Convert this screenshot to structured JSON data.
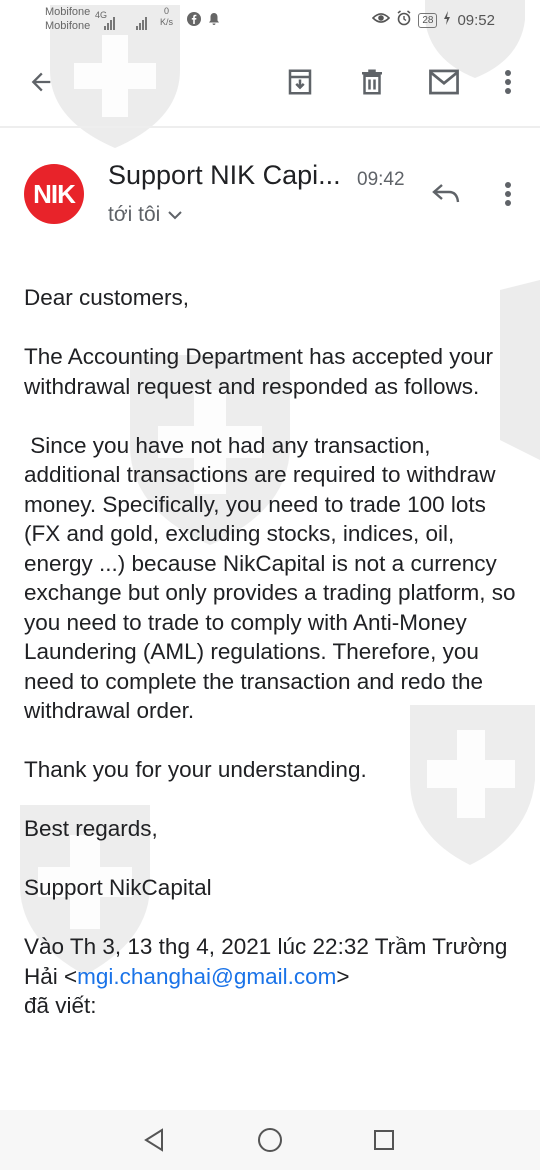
{
  "status_bar": {
    "carrier_1": "Mobifone",
    "carrier_2": "Mobifone",
    "network_1": "4G",
    "speed_value": "0",
    "speed_unit": "K/s",
    "battery": "28",
    "clock": "09:52"
  },
  "toolbar": {
    "icons": [
      "back-arrow-icon",
      "archive-icon",
      "delete-icon",
      "mark-unread-icon",
      "more-vert-icon"
    ]
  },
  "email": {
    "avatar_text": "NIK",
    "sender": "Support NIK Capi...",
    "time": "09:42",
    "recipient_label": "tới tôi",
    "body": {
      "greeting": "Dear customers,",
      "para1": "The Accounting Department has accepted your withdrawal request and responded as follows.",
      "para2": " Since you have not had any transaction, additional transactions are required to withdraw money. Specifically, you need to trade 100 lots (FX and gold, excluding stocks, indices, oil, energy ...) because NikCapital is not a currency exchange but only provides a trading platform, so you need to trade to comply with Anti-Money Laundering (AML) regulations. Therefore, you need to complete the transaction and redo the withdrawal order.",
      "thanks": "Thank you for your understanding.",
      "closing": "Best regards,",
      "signature": "Support NikCapital"
    },
    "quote": {
      "prefix": "Vào Th 3, 13 thg 4, 2021 lúc 22:32 Trầm Trường Hải <",
      "email_link": "mgi.changhai@gmail.com",
      "suffix": ">",
      "wrote": "đã viết:"
    }
  },
  "colors": {
    "avatar_bg": "#e8232a",
    "link": "#1a73e8",
    "secondary_text": "#5f6368"
  }
}
